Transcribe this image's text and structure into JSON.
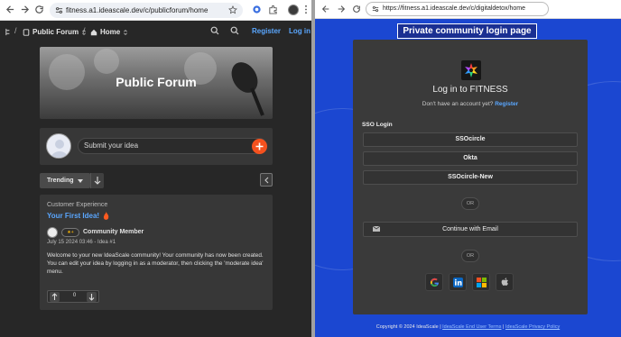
{
  "left": {
    "chrome": {
      "url": "fitness.a1.ideascale.dev/c/publicforum/home"
    },
    "appbar": {
      "community": "Public Forum",
      "home": "Home",
      "register": "Register",
      "login": "Log in"
    },
    "hero": {
      "title": "Public Forum"
    },
    "submit": {
      "placeholder": "Submit your idea"
    },
    "filter": {
      "trending": "Trending"
    },
    "idea": {
      "category": "Customer Experience",
      "title": "Your First Idea!",
      "member": "Community Member",
      "meta": "July 15 2024 03:46 - Idea #1",
      "body": "Welcome to your new IdeaScale community! Your community has now been created. You can edit your idea by logging in as a moderator, then clicking the 'moderate idea' menu.",
      "votes": "0"
    }
  },
  "right": {
    "chrome": {
      "url": "https://fitness.a1.ideascale.dev/c/digitaldetox/home"
    },
    "page_label": "Private community login page",
    "card": {
      "title": "Log in to FITNESS",
      "no_account": "Don't have an account yet?",
      "register": "Register",
      "sso_label": "SSO Login",
      "sso_buttons": [
        "SSOcircle",
        "Okta",
        "SSOcircle-New"
      ],
      "or1": "OR",
      "email_button": "Continue with Email",
      "or2": "OR",
      "social": [
        "google-icon",
        "linkedin-icon",
        "microsoft-icon",
        "apple-icon"
      ]
    },
    "footer": {
      "copyright": "Copyright © 2024 IdeaScale",
      "sep1": "|",
      "terms": "IdeaScale End User Terms",
      "sep2": "|",
      "privacy": "IdeaScale Privacy Policy"
    }
  },
  "colors": {
    "accent": "#5aa7ff",
    "plus": "#f4511e",
    "right_bg": "#1b47d1"
  }
}
